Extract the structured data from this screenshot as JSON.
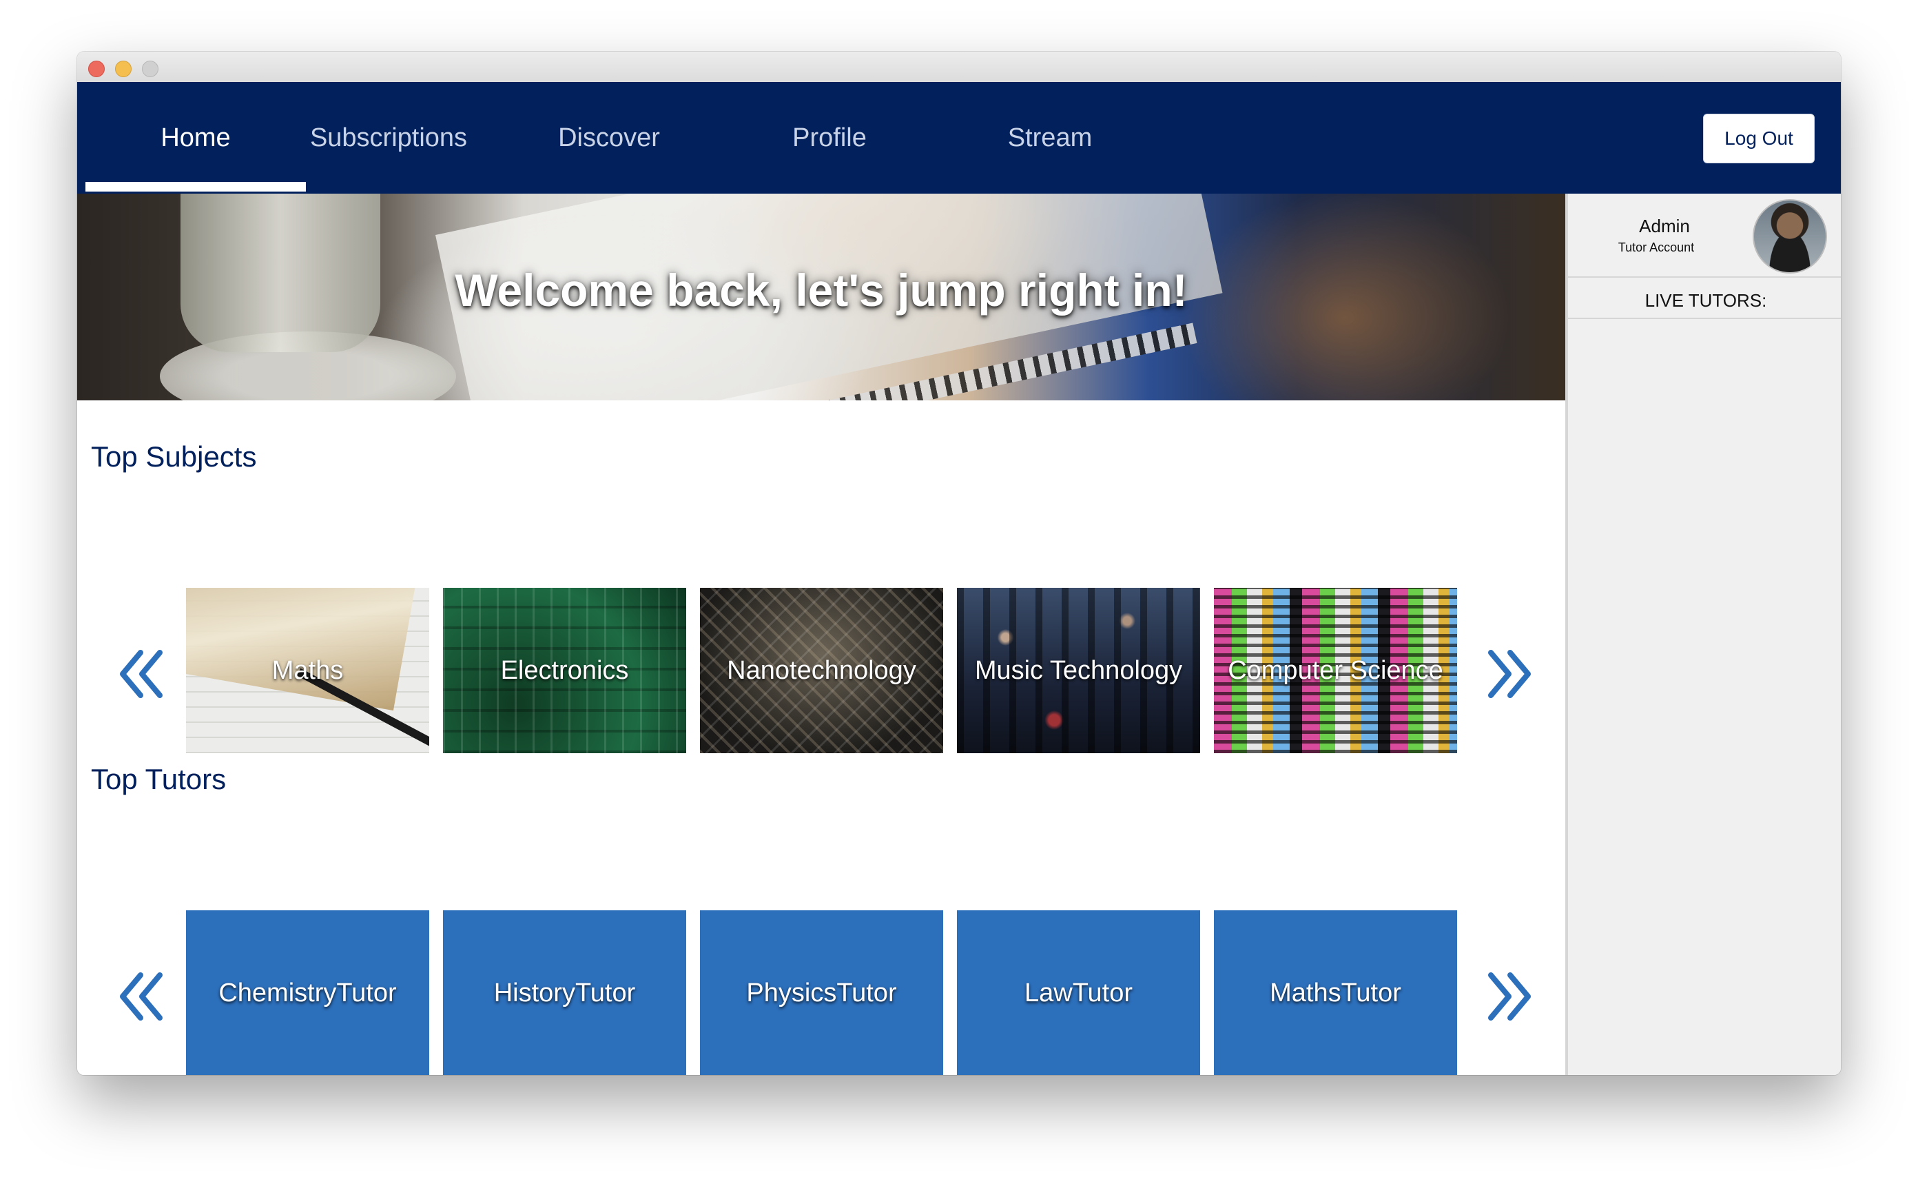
{
  "nav": {
    "items": [
      {
        "label": "Home",
        "active": true
      },
      {
        "label": "Subscriptions",
        "active": false
      },
      {
        "label": "Discover",
        "active": false
      },
      {
        "label": "Profile",
        "active": false
      },
      {
        "label": "Stream",
        "active": false
      }
    ],
    "logout_label": "Log Out"
  },
  "hero": {
    "title": "Welcome back, let's jump right in!"
  },
  "top_subjects": {
    "title": "Top Subjects",
    "items": [
      {
        "label": "Maths"
      },
      {
        "label": "Electronics"
      },
      {
        "label": "Nanotechnology"
      },
      {
        "label": "Music Technology"
      },
      {
        "label": "Computer Science"
      }
    ],
    "prev_icon": "double-chevron-left-icon",
    "next_icon": "double-chevron-right-icon"
  },
  "top_tutors": {
    "title": "Top Tutors",
    "items": [
      {
        "label": "ChemistryTutor"
      },
      {
        "label": "HistoryTutor"
      },
      {
        "label": "PhysicsTutor"
      },
      {
        "label": "LawTutor"
      },
      {
        "label": "MathsTutor"
      }
    ],
    "prev_icon": "double-chevron-left-icon",
    "next_icon": "double-chevron-right-icon"
  },
  "sidebar": {
    "user_name": "Admin",
    "user_role": "Tutor Account",
    "live_tutors_label": "LIVE TUTORS:"
  },
  "colors": {
    "navbar": "#01205c",
    "accent_blue": "#2c6fbb",
    "arrow_blue": "#2c6fbb",
    "sidebar_bg": "#f0f0f0"
  }
}
